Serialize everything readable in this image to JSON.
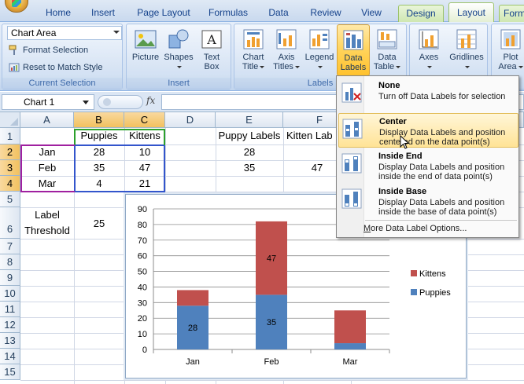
{
  "tabs": [
    "Home",
    "Insert",
    "Page Layout",
    "Formulas",
    "Data",
    "Review",
    "View",
    "Design",
    "Layout",
    "Form"
  ],
  "ribbon": {
    "current_selection": {
      "label": "Current Selection",
      "combo_value": "Chart Area",
      "format_selection": "Format Selection",
      "reset_style": "Reset to Match Style"
    },
    "insert": {
      "label": "Insert",
      "picture": "Picture",
      "shapes": "Shapes",
      "text_box_1": "Text",
      "text_box_2": "Box"
    },
    "labels": {
      "label": "Labels",
      "chart_title_1": "Chart",
      "chart_title_2": "Title",
      "axis_titles_1": "Axis",
      "axis_titles_2": "Titles",
      "legend": "Legend",
      "data_labels_1": "Data",
      "data_labels_2": "Labels",
      "data_table_1": "Data",
      "data_table_2": "Table"
    },
    "axes": {
      "axes": "Axes",
      "gridlines": "Gridlines"
    },
    "background": {
      "plot_area_1": "Plot",
      "plot_area_2": "Area"
    }
  },
  "formula_bar": {
    "name_box": "Chart 1",
    "fx": "fx",
    "content": ""
  },
  "columns": [
    "A",
    "B",
    "C",
    "D",
    "E",
    "F"
  ],
  "rows": [
    "1",
    "2",
    "3",
    "4",
    "5",
    "6",
    "7",
    "8",
    "9",
    "10",
    "11",
    "12",
    "13",
    "14",
    "15"
  ],
  "cells": {
    "B1": "Puppies",
    "C1": "Kittens",
    "E1": "Puppy Labels",
    "F1": "Kitten Lab",
    "A2": "Jan",
    "B2": "28",
    "C2": "10",
    "E2": "28",
    "A3": "Feb",
    "B3": "35",
    "C3": "47",
    "E3": "35",
    "F3": "47",
    "A4": "Mar",
    "B4": "4",
    "C4": "21",
    "A6_line1": "Label",
    "A6_line2": "Threshold",
    "B6": "25"
  },
  "menu": {
    "items": [
      {
        "title": "None",
        "desc": "Turn off Data Labels for selection"
      },
      {
        "title": "Center",
        "desc": "Display Data Labels and position centered on the data point(s)"
      },
      {
        "title": "Inside End",
        "desc": "Display Data Labels and position inside the end of data point(s)"
      },
      {
        "title": "Inside Base",
        "desc": "Display Data Labels and position inside the base of data point(s)"
      }
    ],
    "more_options": "More Data Label Options..."
  },
  "chart_data": {
    "type": "bar",
    "stacked": true,
    "categories": [
      "Jan",
      "Feb",
      "Mar"
    ],
    "series": [
      {
        "name": "Puppies",
        "values": [
          28,
          35,
          4
        ],
        "color": "#4f81bd",
        "labels": [
          "28",
          "35",
          ""
        ]
      },
      {
        "name": "Kittens",
        "values": [
          10,
          47,
          21
        ],
        "color": "#c0504d",
        "labels": [
          "",
          "47",
          ""
        ]
      }
    ],
    "ylim": [
      0,
      90
    ],
    "yticks": [
      0,
      10,
      20,
      30,
      40,
      50,
      60,
      70,
      80,
      90
    ],
    "legend_position": "right",
    "legend_order": [
      "Kittens",
      "Puppies"
    ]
  }
}
